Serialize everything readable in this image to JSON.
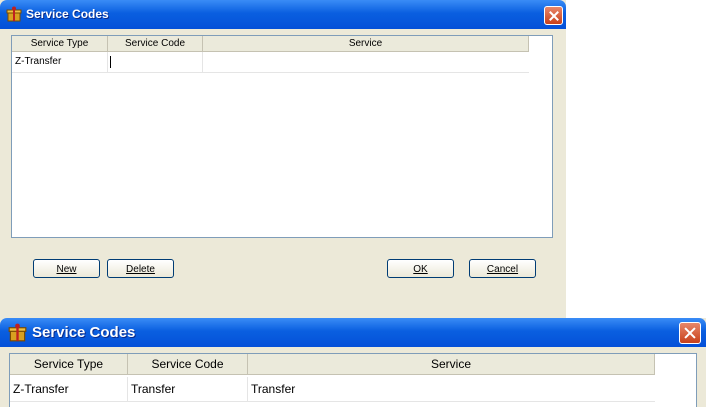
{
  "colors": {
    "titlebar": "#0a5fe0",
    "window_bg": "#ece9d8",
    "close_button": "#c8401a",
    "grid_border": "#7f9db9"
  },
  "window_top": {
    "title": "Service Codes",
    "icon": "app-icon",
    "columns": [
      "Service Type",
      "Service Code",
      "Service"
    ],
    "rows": [
      {
        "service_type": "Z-Transfer",
        "service_code": "",
        "service": ""
      }
    ],
    "buttons": {
      "new": "New",
      "delete": "Delete",
      "ok": "OK",
      "cancel": "Cancel"
    }
  },
  "window_bottom": {
    "title": "Service Codes",
    "icon": "app-icon",
    "columns": [
      "Service Type",
      "Service Code",
      "Service"
    ],
    "rows": [
      {
        "service_type": "Z-Transfer",
        "service_code": "Transfer",
        "service": "Transfer"
      }
    ]
  }
}
